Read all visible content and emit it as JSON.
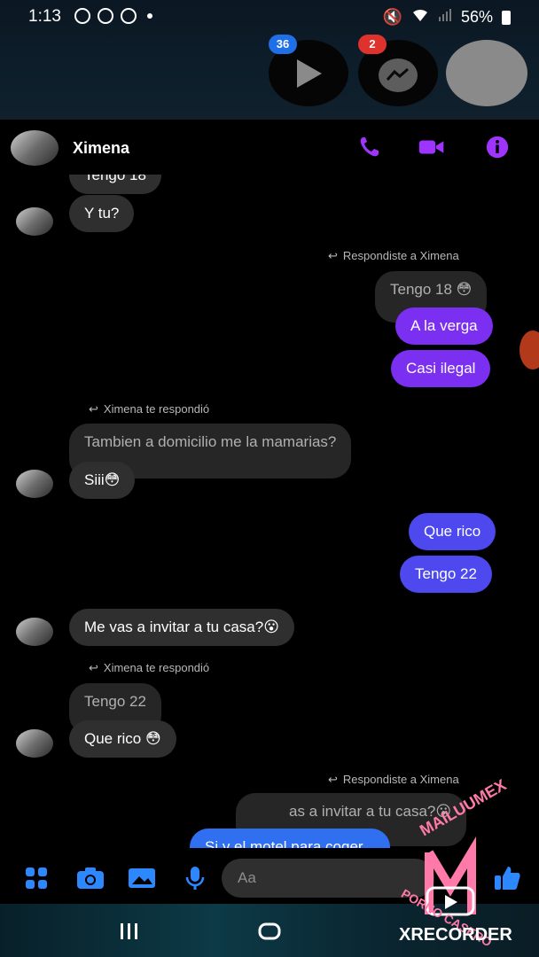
{
  "status_bar": {
    "time": "1:13",
    "battery": "56%"
  },
  "chat_heads": [
    {
      "badge": "36",
      "badge_color": "#1f6fe6"
    },
    {
      "badge": "2",
      "badge_color": "#e0322d"
    }
  ],
  "header": {
    "contact_name": "Ximena"
  },
  "colors": {
    "accent": "#9b30ff",
    "outgoing": "#7b2ff0",
    "outgoing_alt": "#4e49ef",
    "incoming": "#2f2f2f",
    "blue": "#2d88ff"
  },
  "messages": {
    "cut_top": "Tengo 18",
    "m1": "Y tu?",
    "reply_note_1": "Respondiste a Ximena",
    "quote_1": "Tengo 18 😳",
    "m2": "A la verga",
    "m3": "Casi ilegal",
    "reply_note_2": "Ximena te respondió",
    "quote_2": "Tambien a domicilio me la mamarias?",
    "m4": "Siii😳",
    "m5": "Que rico",
    "m6": "Tengo 22",
    "m7": "Me vas a invitar a tu casa?😮",
    "reply_note_3": "Ximena te respondió",
    "quote_3": "Tengo 22",
    "m8": "Que rico 😳",
    "reply_note_4": "Respondiste a Ximena",
    "quote_4": "as a invitar a tu casa?😮",
    "m9": "Si y el motel para coger..."
  },
  "composer": {
    "placeholder": "Aa"
  },
  "watermark": {
    "top": "MAILUUMEX",
    "bottom": "PORNO CASERO",
    "recorder": "XRECORDER"
  }
}
